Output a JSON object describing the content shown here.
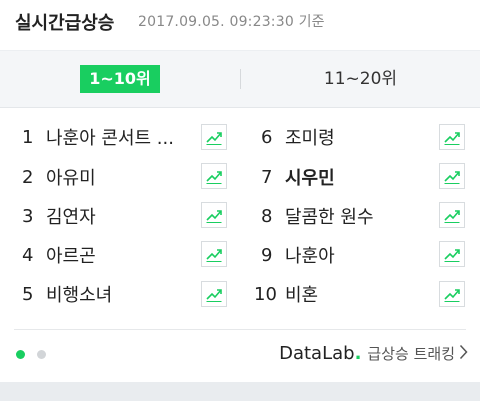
{
  "header": {
    "title": "실시간급상승",
    "timestamp": "2017.09.05. 09:23:30 기준"
  },
  "tabs": [
    {
      "label": "1~10위",
      "active": true
    },
    {
      "label": "11~20위",
      "active": false
    }
  ],
  "ranking": [
    {
      "rank": "1",
      "keyword": "나훈아 콘서트 ..."
    },
    {
      "rank": "2",
      "keyword": "아유미"
    },
    {
      "rank": "3",
      "keyword": "김연자"
    },
    {
      "rank": "4",
      "keyword": "아르곤"
    },
    {
      "rank": "5",
      "keyword": "비행소녀"
    },
    {
      "rank": "6",
      "keyword": "조미령"
    },
    {
      "rank": "7",
      "keyword": "시우민"
    },
    {
      "rank": "8",
      "keyword": "달콤한 원수"
    },
    {
      "rank": "9",
      "keyword": "나훈아"
    },
    {
      "rank": "10",
      "keyword": "비혼"
    }
  ],
  "pager": {
    "pages": 2,
    "current": 1
  },
  "footer": {
    "brand": "DataLab",
    "brand_dot": ".",
    "link_label": "급상승 트래킹"
  },
  "colors": {
    "accent": "#19ce60",
    "trend_icon": "#19ce60"
  },
  "icons": {
    "trend": "trend-chart-icon",
    "chevron": "chevron-right-icon"
  }
}
